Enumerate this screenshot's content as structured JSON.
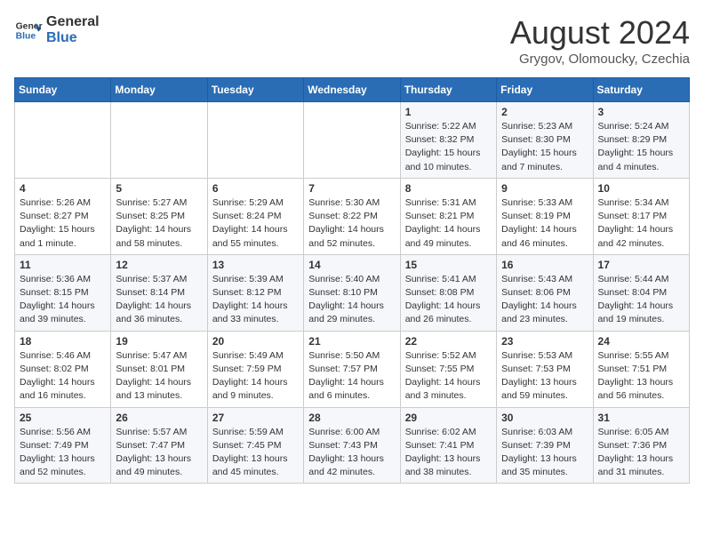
{
  "header": {
    "logo_line1": "General",
    "logo_line2": "Blue",
    "month": "August 2024",
    "location": "Grygov, Olomoucky, Czechia"
  },
  "weekdays": [
    "Sunday",
    "Monday",
    "Tuesday",
    "Wednesday",
    "Thursday",
    "Friday",
    "Saturday"
  ],
  "weeks": [
    [
      {
        "day": "",
        "info": ""
      },
      {
        "day": "",
        "info": ""
      },
      {
        "day": "",
        "info": ""
      },
      {
        "day": "",
        "info": ""
      },
      {
        "day": "1",
        "info": "Sunrise: 5:22 AM\nSunset: 8:32 PM\nDaylight: 15 hours\nand 10 minutes."
      },
      {
        "day": "2",
        "info": "Sunrise: 5:23 AM\nSunset: 8:30 PM\nDaylight: 15 hours\nand 7 minutes."
      },
      {
        "day": "3",
        "info": "Sunrise: 5:24 AM\nSunset: 8:29 PM\nDaylight: 15 hours\nand 4 minutes."
      }
    ],
    [
      {
        "day": "4",
        "info": "Sunrise: 5:26 AM\nSunset: 8:27 PM\nDaylight: 15 hours\nand 1 minute."
      },
      {
        "day": "5",
        "info": "Sunrise: 5:27 AM\nSunset: 8:25 PM\nDaylight: 14 hours\nand 58 minutes."
      },
      {
        "day": "6",
        "info": "Sunrise: 5:29 AM\nSunset: 8:24 PM\nDaylight: 14 hours\nand 55 minutes."
      },
      {
        "day": "7",
        "info": "Sunrise: 5:30 AM\nSunset: 8:22 PM\nDaylight: 14 hours\nand 52 minutes."
      },
      {
        "day": "8",
        "info": "Sunrise: 5:31 AM\nSunset: 8:21 PM\nDaylight: 14 hours\nand 49 minutes."
      },
      {
        "day": "9",
        "info": "Sunrise: 5:33 AM\nSunset: 8:19 PM\nDaylight: 14 hours\nand 46 minutes."
      },
      {
        "day": "10",
        "info": "Sunrise: 5:34 AM\nSunset: 8:17 PM\nDaylight: 14 hours\nand 42 minutes."
      }
    ],
    [
      {
        "day": "11",
        "info": "Sunrise: 5:36 AM\nSunset: 8:15 PM\nDaylight: 14 hours\nand 39 minutes."
      },
      {
        "day": "12",
        "info": "Sunrise: 5:37 AM\nSunset: 8:14 PM\nDaylight: 14 hours\nand 36 minutes."
      },
      {
        "day": "13",
        "info": "Sunrise: 5:39 AM\nSunset: 8:12 PM\nDaylight: 14 hours\nand 33 minutes."
      },
      {
        "day": "14",
        "info": "Sunrise: 5:40 AM\nSunset: 8:10 PM\nDaylight: 14 hours\nand 29 minutes."
      },
      {
        "day": "15",
        "info": "Sunrise: 5:41 AM\nSunset: 8:08 PM\nDaylight: 14 hours\nand 26 minutes."
      },
      {
        "day": "16",
        "info": "Sunrise: 5:43 AM\nSunset: 8:06 PM\nDaylight: 14 hours\nand 23 minutes."
      },
      {
        "day": "17",
        "info": "Sunrise: 5:44 AM\nSunset: 8:04 PM\nDaylight: 14 hours\nand 19 minutes."
      }
    ],
    [
      {
        "day": "18",
        "info": "Sunrise: 5:46 AM\nSunset: 8:02 PM\nDaylight: 14 hours\nand 16 minutes."
      },
      {
        "day": "19",
        "info": "Sunrise: 5:47 AM\nSunset: 8:01 PM\nDaylight: 14 hours\nand 13 minutes."
      },
      {
        "day": "20",
        "info": "Sunrise: 5:49 AM\nSunset: 7:59 PM\nDaylight: 14 hours\nand 9 minutes."
      },
      {
        "day": "21",
        "info": "Sunrise: 5:50 AM\nSunset: 7:57 PM\nDaylight: 14 hours\nand 6 minutes."
      },
      {
        "day": "22",
        "info": "Sunrise: 5:52 AM\nSunset: 7:55 PM\nDaylight: 14 hours\nand 3 minutes."
      },
      {
        "day": "23",
        "info": "Sunrise: 5:53 AM\nSunset: 7:53 PM\nDaylight: 13 hours\nand 59 minutes."
      },
      {
        "day": "24",
        "info": "Sunrise: 5:55 AM\nSunset: 7:51 PM\nDaylight: 13 hours\nand 56 minutes."
      }
    ],
    [
      {
        "day": "25",
        "info": "Sunrise: 5:56 AM\nSunset: 7:49 PM\nDaylight: 13 hours\nand 52 minutes."
      },
      {
        "day": "26",
        "info": "Sunrise: 5:57 AM\nSunset: 7:47 PM\nDaylight: 13 hours\nand 49 minutes."
      },
      {
        "day": "27",
        "info": "Sunrise: 5:59 AM\nSunset: 7:45 PM\nDaylight: 13 hours\nand 45 minutes."
      },
      {
        "day": "28",
        "info": "Sunrise: 6:00 AM\nSunset: 7:43 PM\nDaylight: 13 hours\nand 42 minutes."
      },
      {
        "day": "29",
        "info": "Sunrise: 6:02 AM\nSunset: 7:41 PM\nDaylight: 13 hours\nand 38 minutes."
      },
      {
        "day": "30",
        "info": "Sunrise: 6:03 AM\nSunset: 7:39 PM\nDaylight: 13 hours\nand 35 minutes."
      },
      {
        "day": "31",
        "info": "Sunrise: 6:05 AM\nSunset: 7:36 PM\nDaylight: 13 hours\nand 31 minutes."
      }
    ]
  ]
}
